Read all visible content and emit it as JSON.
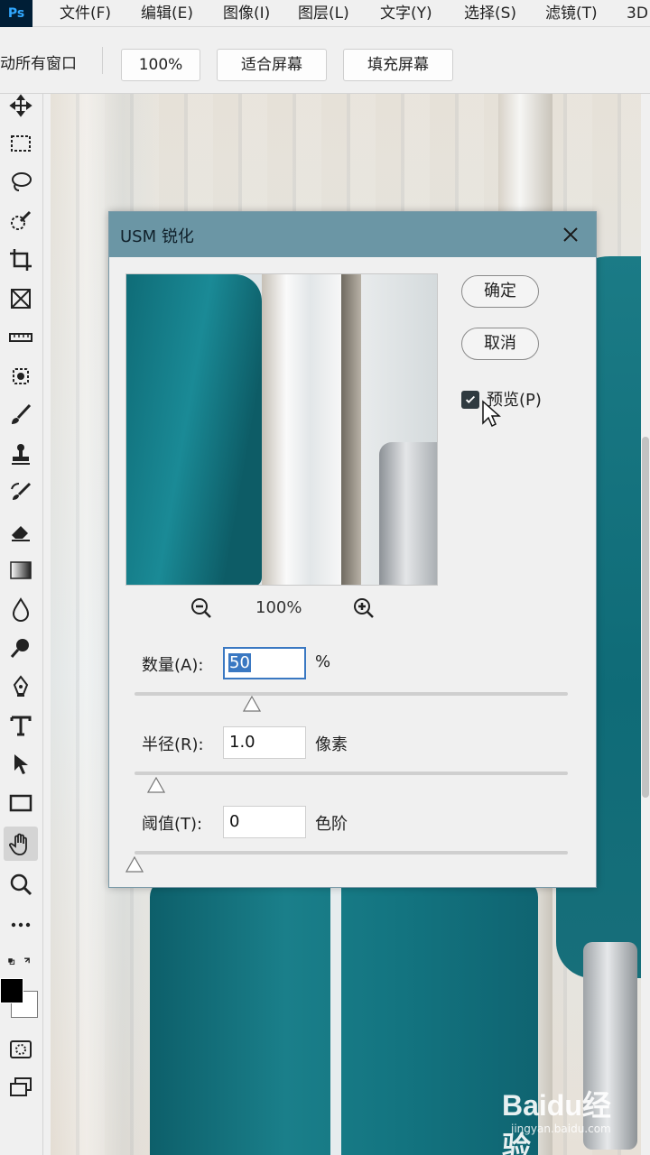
{
  "app": {
    "logo_text": "Ps"
  },
  "menu": {
    "items": [
      "文件(F)",
      "编辑(E)",
      "图像(I)",
      "图层(L)",
      "文字(Y)",
      "选择(S)",
      "滤镜(T)",
      "3D"
    ]
  },
  "options_bar": {
    "all_windows_label": "动所有窗口",
    "zoom_value": "100%",
    "fit_screen_label": "适合屏幕",
    "fill_screen_label": "填充屏幕"
  },
  "toolbar": {
    "tools": [
      "move-tool-icon",
      "rect-marquee-icon",
      "lasso-icon",
      "quick-select-icon",
      "crop-icon",
      "frame-icon",
      "ruler-icon",
      "healing-icon",
      "brush-icon",
      "stamp-icon",
      "history-brush-icon",
      "eraser-icon",
      "gradient-icon",
      "blur-icon",
      "dodge-icon",
      "pen-icon",
      "type-icon",
      "path-select-icon",
      "rectangle-icon",
      "hand-icon",
      "zoom-icon",
      "more-icon"
    ],
    "active_tool": "hand-icon",
    "foreground_color": "#000000",
    "background_color": "#ffffff"
  },
  "dialog": {
    "title": "USM 锐化",
    "ok_label": "确定",
    "cancel_label": "取消",
    "preview_label": "预览(P)",
    "preview_checked": true,
    "zoom_pct": "100%",
    "amount": {
      "label": "数量(A):",
      "value": "50",
      "unit": "%",
      "slider_level": 0.27
    },
    "radius": {
      "label": "半径(R):",
      "value": "1.0",
      "unit": "像素",
      "slider_level": 0.05
    },
    "threshold": {
      "label": "阈值(T):",
      "value": "0",
      "unit": "色阶",
      "slider_level": 0.0
    },
    "title_bar_color": "#6b96a5"
  },
  "watermark": {
    "logo": "Baidu经验",
    "sub": "jingyan.baidu.com"
  }
}
